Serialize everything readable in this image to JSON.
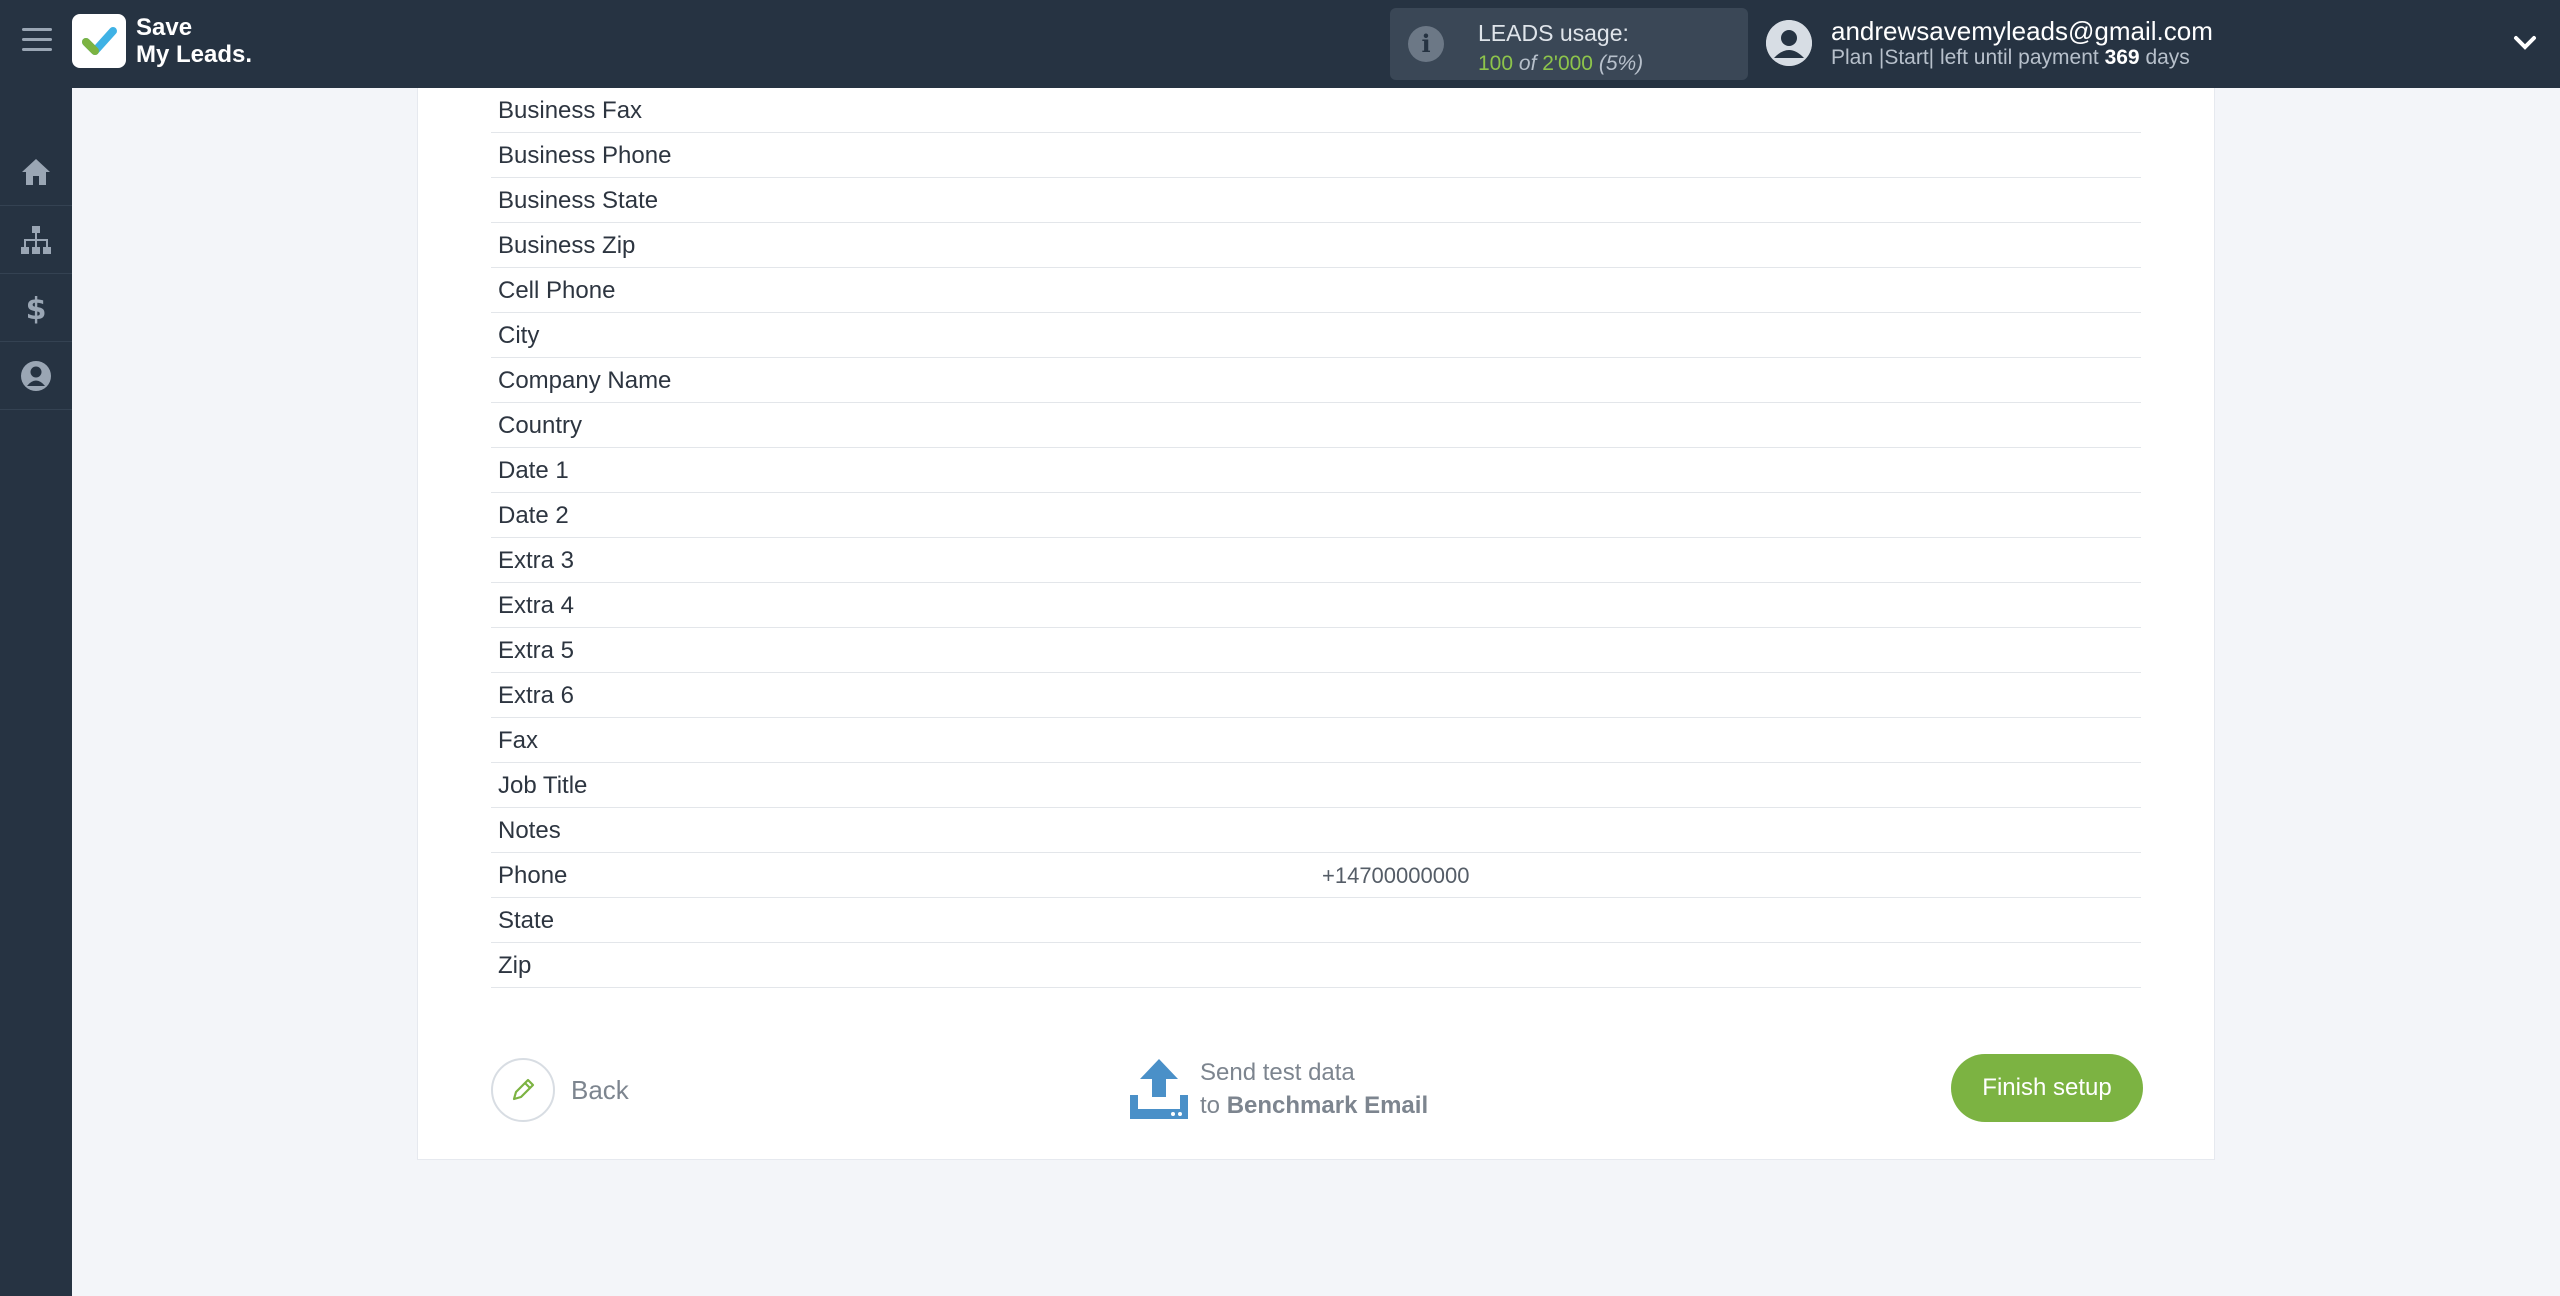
{
  "header": {
    "brand_line1": "Save",
    "brand_line2": "My Leads.",
    "usage_title": "LEADS usage:",
    "usage_used": "100",
    "usage_of": "of",
    "usage_total": "2'000",
    "usage_percent": "(5%)",
    "email": "andrewsavemyleads@gmail.com",
    "plan_prefix": "Plan |Start| left until payment",
    "plan_days": "369",
    "plan_suffix": "days"
  },
  "sidebar": {
    "items": [
      {
        "icon": "home-icon"
      },
      {
        "icon": "sitemap-icon"
      },
      {
        "icon": "dollar-icon"
      },
      {
        "icon": "user-icon"
      }
    ]
  },
  "fields": [
    {
      "label": "Business Fax",
      "value": ""
    },
    {
      "label": "Business Phone",
      "value": ""
    },
    {
      "label": "Business State",
      "value": ""
    },
    {
      "label": "Business Zip",
      "value": ""
    },
    {
      "label": "Cell Phone",
      "value": ""
    },
    {
      "label": "City",
      "value": ""
    },
    {
      "label": "Company Name",
      "value": ""
    },
    {
      "label": "Country",
      "value": ""
    },
    {
      "label": "Date 1",
      "value": ""
    },
    {
      "label": "Date 2",
      "value": ""
    },
    {
      "label": "Extra 3",
      "value": ""
    },
    {
      "label": "Extra 4",
      "value": ""
    },
    {
      "label": "Extra 5",
      "value": ""
    },
    {
      "label": "Extra 6",
      "value": ""
    },
    {
      "label": "Fax",
      "value": ""
    },
    {
      "label": "Job Title",
      "value": ""
    },
    {
      "label": "Notes",
      "value": ""
    },
    {
      "label": "Phone",
      "value": "+14700000000"
    },
    {
      "label": "State",
      "value": ""
    },
    {
      "label": "Zip",
      "value": ""
    }
  ],
  "actions": {
    "back_label": "Back",
    "send_line1": "Send test data",
    "send_to": "to",
    "send_target": "Benchmark Email",
    "finish_label": "Finish setup"
  },
  "colors": {
    "topbar": "#263342",
    "accent_green": "#7cb342",
    "upload_blue": "#4a90c8"
  }
}
